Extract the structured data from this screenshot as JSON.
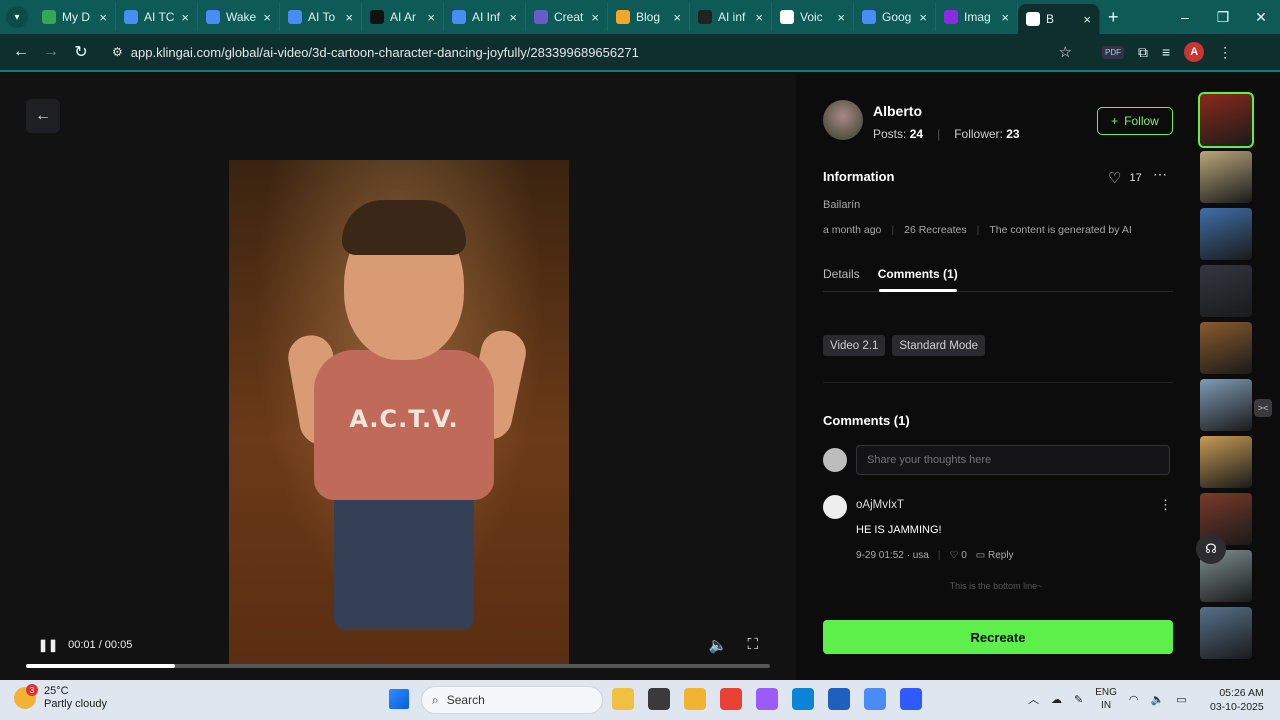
{
  "browser": {
    "tabs": [
      {
        "title": "My D",
        "icon": "drive-icon",
        "color": "#34a853"
      },
      {
        "title": "AI TC",
        "icon": "docs-icon",
        "color": "#4a8bf5"
      },
      {
        "title": "Wake",
        "icon": "docs-icon",
        "color": "#4a8bf5"
      },
      {
        "title": "AI To",
        "icon": "docs-icon",
        "color": "#4a8bf5"
      },
      {
        "title": "AI Ar",
        "icon": "f-icon",
        "color": "#111111"
      },
      {
        "title": "AI Inf",
        "icon": "docs-icon",
        "color": "#4a8bf5"
      },
      {
        "title": "Creat",
        "icon": "link-icon",
        "color": "#6a5acd"
      },
      {
        "title": "Blog",
        "icon": "blogger-icon",
        "color": "#f5a623"
      },
      {
        "title": "AI inf",
        "icon": "dark-icon",
        "color": "#222222"
      },
      {
        "title": "Voic",
        "icon": "voice-icon",
        "color": "#ffffff"
      },
      {
        "title": "Goog",
        "icon": "gemini-icon",
        "color": "#4a8bf5"
      },
      {
        "title": "Imag",
        "icon": "image-icon",
        "color": "#8a2be2"
      },
      {
        "title": "B",
        "icon": "kling-icon",
        "color": "#ffffff",
        "active": true
      }
    ],
    "url": "app.klingai.com/global/ai-video/3d-cartoon-character-dancing-joyfully/283399689656271",
    "pdf_label": "PDF"
  },
  "player": {
    "time": "00:01 / 00:05",
    "progress_fraction": 0.2,
    "shirt_text": "A.C.T.V."
  },
  "creator": {
    "name": "Alberto",
    "posts_label": "Posts:",
    "posts": "24",
    "followers_label": "Follower:",
    "followers": "23",
    "follow_label": "Follow"
  },
  "info": {
    "heading": "Information",
    "likes": "17",
    "title": "Bailarín",
    "age": "a month ago",
    "recreates": "26 Recreates",
    "ai_note": "The content is generated by AI"
  },
  "tabs": {
    "details": "Details",
    "comments": "Comments (1)"
  },
  "chips": [
    "Video 2.1",
    "Standard Mode"
  ],
  "comments": {
    "heading": "Comments (1)",
    "placeholder": "Share your thoughts here",
    "items": [
      {
        "user": "oAjMvIxT",
        "text": "HE IS JAMMING!",
        "meta": "9-29 01:52 · usa",
        "likes": "0",
        "reply": "Reply"
      }
    ],
    "bottom_line": "This is the bottom line~"
  },
  "recreate_label": "Recreate",
  "thumbs": [
    {
      "color": "#8a2a1c",
      "selected": true
    },
    {
      "color": "#b9a77a"
    },
    {
      "color": "#3f6fa8"
    },
    {
      "color": "#333740"
    },
    {
      "color": "#8a5a2c"
    },
    {
      "color": "#7f9ab5"
    },
    {
      "color": "#c79a55"
    },
    {
      "color": "#7a3a2a"
    },
    {
      "color": "#7e8f8f"
    },
    {
      "color": "#56708a"
    }
  ],
  "taskbar": {
    "temp": "25°C",
    "weather": "Partly cloudy",
    "weather_badge": "3",
    "search": "Search",
    "lang1": "ENG",
    "lang2": "IN",
    "time": "05:26 AM",
    "date": "03-10-2025",
    "apps": [
      "#f0c040",
      "#3a3a3a",
      "#f2b233",
      "#e94235",
      "#9b5cf6",
      "#0a84d6",
      "#1f5fbf",
      "#4a8bf5",
      "#2d5bff"
    ]
  }
}
